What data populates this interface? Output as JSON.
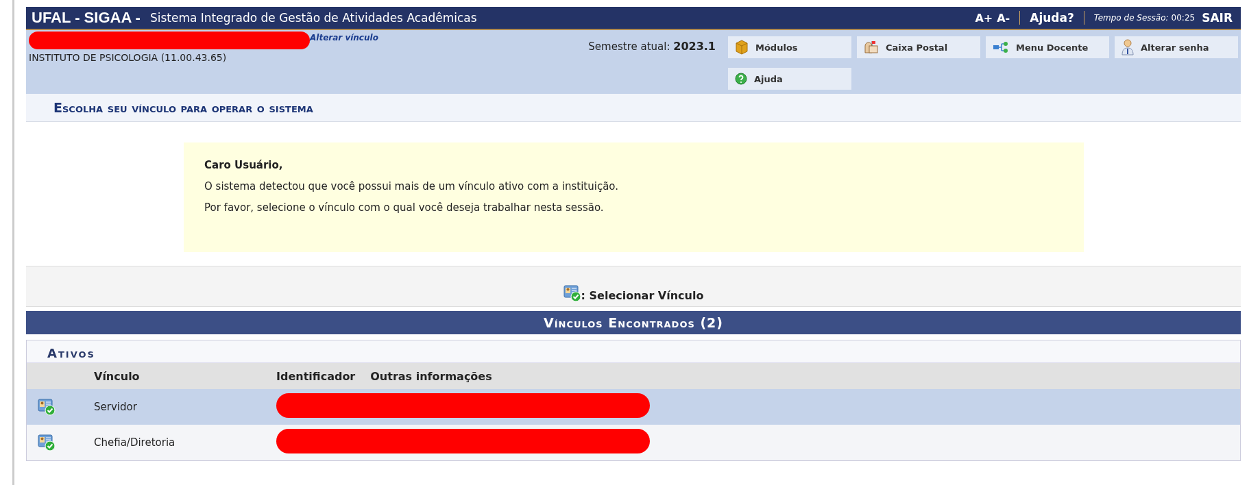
{
  "header": {
    "brand": "UFAL - SIGAA -",
    "system_name": "Sistema Integrado de Gestão de Atividades Acadêmicas",
    "font_larger": "A+",
    "font_smaller": "A-",
    "help": "Ajuda?",
    "session_label": "Tempo de Sessão:",
    "session_time": "00:25",
    "logout": "SAIR"
  },
  "user_info": {
    "change_link": "Alterar vínculo",
    "unit": "INSTITUTO DE PSICOLOGIA (11.00.43.65)",
    "semester_label": "Semestre atual:",
    "semester": "2023.1"
  },
  "menu_buttons": [
    {
      "kind": "modules",
      "label": "Módulos"
    },
    {
      "kind": "mail",
      "label": "Caixa Postal"
    },
    {
      "kind": "menu",
      "label": "Menu Docente"
    },
    {
      "kind": "password",
      "label": "Alterar senha"
    },
    {
      "kind": "help",
      "label": "Ajuda"
    }
  ],
  "page_title": "Escolha seu vínculo para operar o sistema",
  "notice": {
    "greeting": "Caro Usuário,",
    "lines": [
      "O sistema detectou que você possui mais de um vínculo ativo com a instituição.",
      "Por favor, selecione o vínculo com o qual você deseja trabalhar nesta sessão."
    ]
  },
  "legend": ": Selecionar Vínculo",
  "table": {
    "title": "Vínculos Encontrados (2)",
    "section": "Ativos",
    "columns": [
      "Vínculo",
      "Identificador",
      "Outras informações"
    ],
    "rows": [
      {
        "vinculo": "Servidor",
        "selected": true
      },
      {
        "vinculo": "Chefia/Diretoria",
        "selected": false
      }
    ]
  }
}
